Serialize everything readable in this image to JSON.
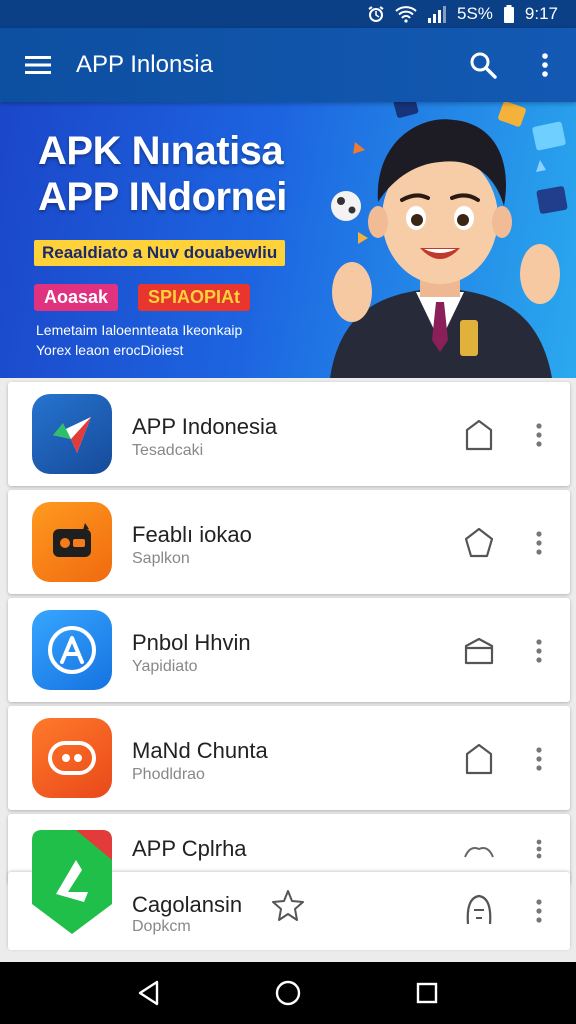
{
  "status_bar": {
    "battery_text": "5S%",
    "time": "9:17",
    "icons": [
      "alarm-icon",
      "wifi-icon",
      "signal-icon",
      "battery-icon"
    ]
  },
  "app_bar": {
    "title": "APP Inlonsia",
    "icons": [
      "menu-icon",
      "search-icon",
      "more-vert-icon"
    ]
  },
  "banner": {
    "headline_line1": "APK Nınatisa",
    "headline_line2": "APP INdornei",
    "tagline": "Reaaldiato a Nuv douabewliu",
    "tag1": "Aoasak",
    "tag2": "SPIAOPIAt",
    "desc_line1": "Lemetaim Ialoennteata Ikeonkaip",
    "desc_line2": "Yorex leaon erocDioiest"
  },
  "apps": [
    {
      "name": "APP Indonesia",
      "sub": "Tesadcaki",
      "icon": "paper-plane-icon",
      "color": "#1e63b8"
    },
    {
      "name": "Feablı iokao",
      "sub": "Saplkon",
      "icon": "ticket-icon",
      "color": "#f57c18"
    },
    {
      "name": "Pnbol Hhvin",
      "sub": "Yapidiato",
      "icon": "app-store-icon",
      "color": "#1e8cf0"
    },
    {
      "name": "MaNd Chunta",
      "sub": "Phodldrao",
      "icon": "gamepad-icon",
      "color": "#f25a1f"
    },
    {
      "name": "APP Cplrha",
      "sub": "",
      "icon": "",
      "color": ""
    },
    {
      "name": "Cagolansin",
      "sub": "Dopkcm",
      "icon": "play-arrow-icon",
      "color": "#1fbf4a"
    }
  ],
  "nav_bar": {
    "icons": [
      "back-icon",
      "home-icon",
      "recents-icon"
    ]
  }
}
